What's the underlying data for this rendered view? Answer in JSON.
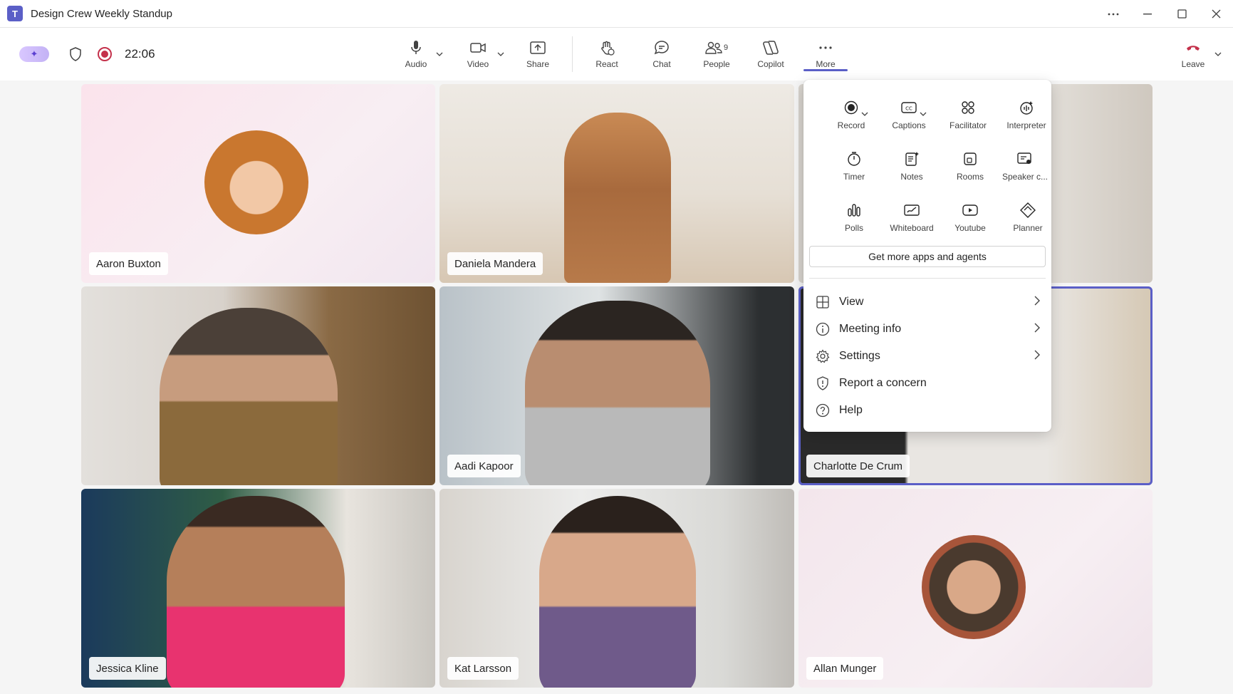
{
  "window": {
    "title": "Design Crew Weekly Standup",
    "controls": [
      "more-options",
      "minimize",
      "maximize",
      "close"
    ]
  },
  "toolbar": {
    "timer": "22:06",
    "audio_label": "Audio",
    "video_label": "Video",
    "share_label": "Share",
    "react_label": "React",
    "chat_label": "Chat",
    "people_label": "People",
    "people_count": "9",
    "copilot_label": "Copilot",
    "more_label": "More",
    "leave_label": "Leave"
  },
  "colors": {
    "accent": "#5b5fc7",
    "recording": "#c4314b",
    "leave": "#c4314b"
  },
  "participants": [
    {
      "name": "Aaron Buxton",
      "type": "avatar"
    },
    {
      "name": "Daniela Mandera",
      "type": "video"
    },
    {
      "name": "",
      "type": "video"
    },
    {
      "name": "",
      "type": "video"
    },
    {
      "name": "Aadi Kapoor",
      "type": "video"
    },
    {
      "name": "Charlotte De Crum",
      "type": "video",
      "selected": true
    },
    {
      "name": "Jessica Kline",
      "type": "video"
    },
    {
      "name": "Kat Larsson",
      "type": "video"
    },
    {
      "name": "Allan Munger",
      "type": "avatar"
    }
  ],
  "more_menu": {
    "apps": [
      {
        "label": "Record",
        "icon": "record-icon"
      },
      {
        "label": "Captions",
        "icon": "captions-icon"
      },
      {
        "label": "Facilitator",
        "icon": "facilitator-icon"
      },
      {
        "label": "Interpreter",
        "icon": "interpreter-icon"
      },
      {
        "label": "Timer",
        "icon": "timer-icon"
      },
      {
        "label": "Notes",
        "icon": "notes-icon"
      },
      {
        "label": "Rooms",
        "icon": "rooms-icon"
      },
      {
        "label": "Speaker c...",
        "icon": "speaker-coach-icon"
      },
      {
        "label": "Polls",
        "icon": "polls-icon"
      },
      {
        "label": "Whiteboard",
        "icon": "whiteboard-icon"
      },
      {
        "label": "Youtube",
        "icon": "youtube-icon"
      },
      {
        "label": "Planner",
        "icon": "planner-icon"
      }
    ],
    "get_more_label": "Get more apps and agents",
    "items": [
      {
        "label": "View",
        "icon": "view-grid-icon"
      },
      {
        "label": "Meeting info",
        "icon": "info-icon"
      },
      {
        "label": "Settings",
        "icon": "settings-gear-icon"
      },
      {
        "label": "Report a concern",
        "icon": "shield-alert-icon"
      },
      {
        "label": "Help",
        "icon": "help-icon"
      }
    ]
  }
}
